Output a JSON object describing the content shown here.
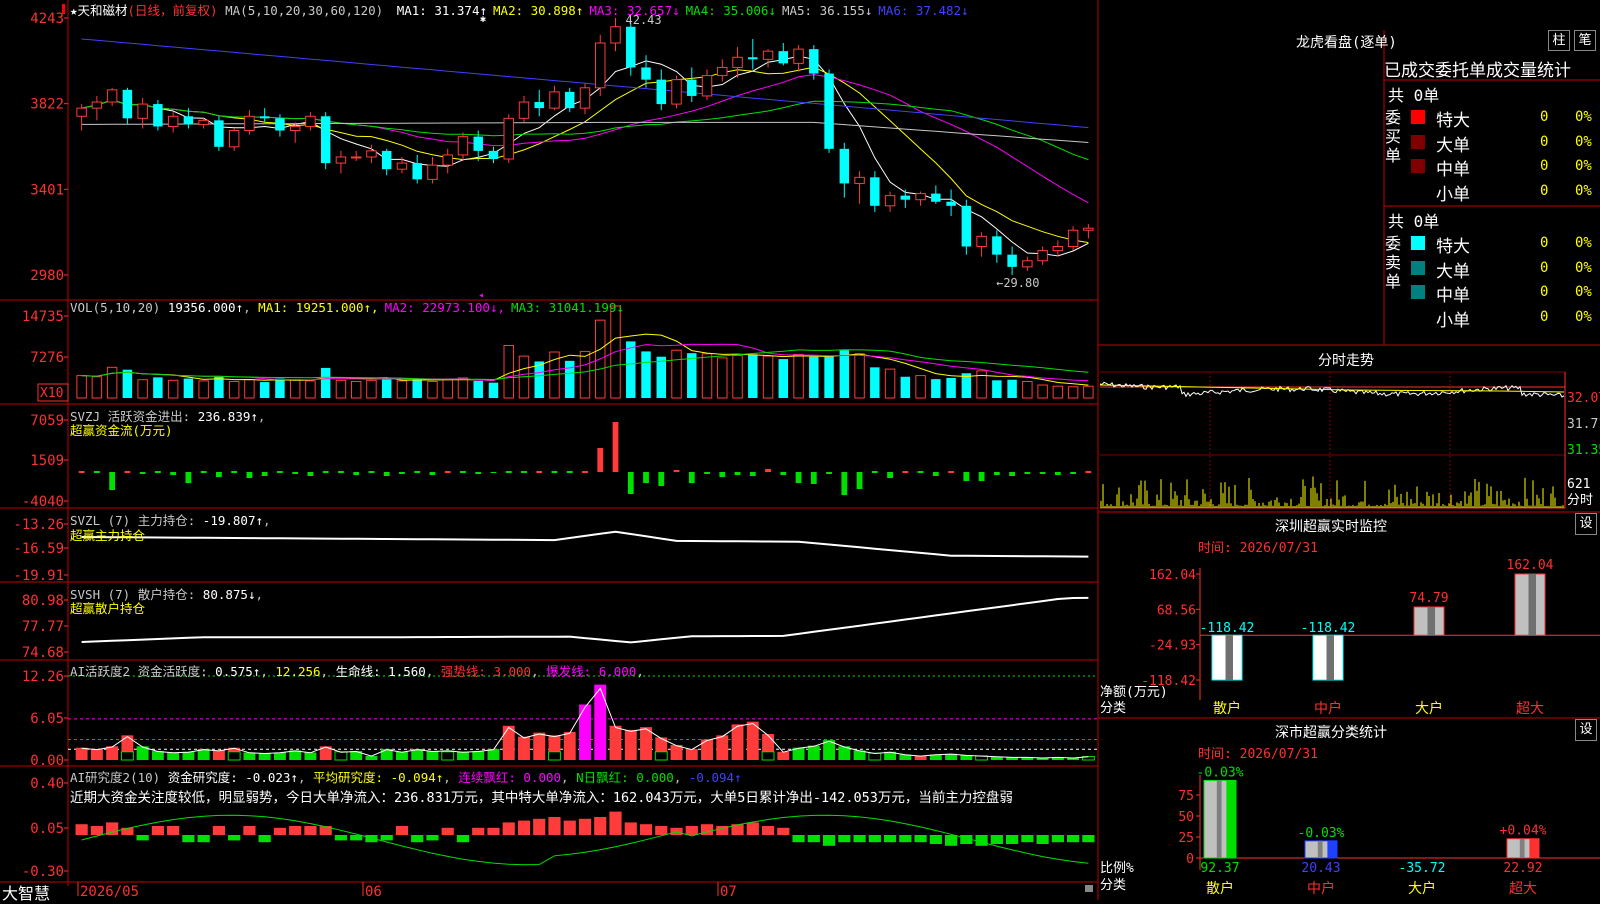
{
  "colors": {
    "up": "#ff3b3b",
    "down": "#00ffff",
    "green": "#00e000",
    "grid": "#c00000",
    "white": "#e8e8e8",
    "yellow": "#ffff00",
    "magenta": "#ff00ff",
    "blue": "#4040ff",
    "text": "#c8c8c8"
  },
  "main": {
    "stock_name": "★天和磁材",
    "period": "(日线，前复权)",
    "ma_header": "MA(5,10,20,30,60,120)",
    "ma": [
      {
        "label": "MA1:",
        "value": "31.374↑",
        "color": "#ffffff"
      },
      {
        "label": "MA2:",
        "value": "30.898↑",
        "color": "#ffff00"
      },
      {
        "label": "MA3:",
        "value": "32.657↓",
        "color": "#ff00ff"
      },
      {
        "label": "MA4:",
        "value": "35.006↓",
        "color": "#00e000"
      },
      {
        "label": "MA5:",
        "value": "36.155↓",
        "color": "#c8c8c8"
      },
      {
        "label": "MA6:",
        "value": "37.482↓",
        "color": "#4040ff"
      }
    ],
    "y_labels": [
      "4243",
      "3822",
      "3401",
      "2980"
    ],
    "high_label": "42.43",
    "low_label": "←29.80",
    "candles": [
      [
        37.6,
        38.2,
        36.9,
        38.0
      ],
      [
        38.0,
        38.6,
        37.4,
        38.3
      ],
      [
        38.3,
        39.0,
        38.1,
        38.9
      ],
      [
        38.9,
        39.0,
        37.2,
        37.5
      ],
      [
        37.5,
        38.5,
        37.0,
        38.2
      ],
      [
        38.2,
        38.4,
        36.9,
        37.1
      ],
      [
        37.1,
        37.8,
        36.8,
        37.6
      ],
      [
        37.6,
        38.0,
        37.0,
        37.2
      ],
      [
        37.2,
        37.5,
        37.0,
        37.4
      ],
      [
        37.4,
        37.6,
        35.9,
        36.1
      ],
      [
        36.1,
        37.0,
        35.9,
        36.9
      ],
      [
        36.9,
        37.9,
        36.7,
        37.6
      ],
      [
        37.6,
        38.0,
        37.3,
        37.5
      ],
      [
        37.5,
        37.7,
        36.6,
        36.9
      ],
      [
        36.9,
        37.3,
        36.3,
        37.1
      ],
      [
        37.1,
        37.8,
        36.9,
        37.6
      ],
      [
        37.6,
        37.8,
        35.0,
        35.3
      ],
      [
        35.3,
        35.9,
        34.8,
        35.6
      ],
      [
        35.6,
        35.9,
        35.4,
        35.6
      ],
      [
        35.6,
        36.2,
        35.3,
        35.9
      ],
      [
        35.9,
        36.0,
        34.7,
        35.0
      ],
      [
        35.0,
        35.6,
        34.8,
        35.3
      ],
      [
        35.3,
        35.7,
        34.3,
        34.5
      ],
      [
        34.5,
        35.6,
        34.3,
        35.2
      ],
      [
        35.2,
        36.0,
        34.8,
        35.7
      ],
      [
        35.7,
        36.8,
        35.4,
        36.6
      ],
      [
        36.6,
        36.9,
        35.4,
        35.9
      ],
      [
        35.9,
        36.1,
        35.3,
        35.5
      ],
      [
        35.5,
        37.7,
        35.3,
        37.5
      ],
      [
        37.5,
        38.6,
        37.3,
        38.3
      ],
      [
        38.3,
        38.9,
        37.6,
        38.0
      ],
      [
        38.0,
        39.1,
        37.9,
        38.8
      ],
      [
        38.8,
        39.0,
        37.8,
        38.0
      ],
      [
        38.0,
        39.2,
        37.7,
        39.0
      ],
      [
        39.0,
        41.6,
        38.6,
        41.2
      ],
      [
        41.2,
        42.43,
        40.8,
        42.0
      ],
      [
        42.0,
        42.2,
        39.6,
        40.0
      ],
      [
        40.0,
        40.6,
        39.0,
        39.4
      ],
      [
        39.4,
        39.9,
        37.9,
        38.2
      ],
      [
        38.2,
        39.6,
        38.0,
        39.4
      ],
      [
        39.4,
        40.0,
        38.3,
        38.6
      ],
      [
        38.6,
        39.9,
        38.4,
        39.6
      ],
      [
        39.6,
        40.4,
        39.3,
        40.0
      ],
      [
        40.0,
        41.0,
        39.5,
        40.5
      ],
      [
        40.5,
        41.4,
        39.9,
        40.4
      ],
      [
        40.4,
        40.9,
        40.0,
        40.8
      ],
      [
        40.8,
        41.2,
        40.1,
        40.2
      ],
      [
        40.2,
        41.1,
        39.8,
        40.9
      ],
      [
        40.9,
        41.1,
        39.4,
        39.7
      ],
      [
        39.7,
        39.9,
        35.8,
        36.0
      ],
      [
        36.0,
        36.3,
        33.6,
        34.3
      ],
      [
        34.3,
        34.9,
        33.3,
        34.6
      ],
      [
        34.6,
        34.9,
        32.9,
        33.2
      ],
      [
        33.2,
        33.9,
        32.9,
        33.7
      ],
      [
        33.7,
        34.0,
        33.1,
        33.5
      ],
      [
        33.5,
        33.9,
        33.2,
        33.8
      ],
      [
        33.8,
        34.2,
        33.3,
        33.4
      ],
      [
        33.4,
        34.0,
        32.7,
        33.2
      ],
      [
        33.2,
        33.5,
        30.8,
        31.2
      ],
      [
        31.2,
        31.9,
        30.7,
        31.7
      ],
      [
        31.7,
        32.0,
        30.4,
        30.8
      ],
      [
        30.8,
        31.2,
        29.8,
        30.2
      ],
      [
        30.2,
        30.7,
        30.0,
        30.5
      ],
      [
        30.5,
        31.2,
        30.3,
        31.0
      ],
      [
        31.0,
        31.5,
        30.7,
        31.2
      ],
      [
        31.2,
        32.2,
        31.0,
        32.0
      ],
      [
        32.0,
        32.3,
        31.6,
        32.1
      ]
    ]
  },
  "vol": {
    "header": "VOL(5,10,20)",
    "value": "19356.000↑",
    "ma": [
      {
        "label": "MA1:",
        "value": "19251.000↑",
        "color": "#ffff00"
      },
      {
        "label": "MA2:",
        "value": "22973.100↓",
        "color": "#ff00ff"
      },
      {
        "label": "MA3:",
        "value": "31041.199↓",
        "color": "#00e000"
      }
    ],
    "y_labels": [
      "14735",
      "7276"
    ],
    "unit": "X10",
    "bars": [
      3.8,
      3.6,
      5.2,
      4.8,
      3.1,
      3.5,
      3.0,
      3.3,
      2.9,
      3.6,
      2.8,
      3.1,
      2.7,
      3.3,
      3.1,
      2.9,
      5.1,
      3.0,
      2.8,
      3.0,
      3.4,
      2.9,
      3.2,
      2.8,
      3.1,
      3.4,
      2.9,
      2.6,
      8.9,
      7.1,
      6.2,
      7.8,
      6.3,
      7.9,
      13.2,
      15.6,
      9.6,
      7.9,
      7.0,
      8.1,
      7.6,
      7.5,
      6.8,
      7.2,
      7.4,
      7.1,
      6.6,
      7.4,
      7.0,
      7.2,
      8.1,
      7.5,
      5.2,
      4.9,
      3.6,
      3.8,
      3.2,
      3.4,
      4.2,
      4.6,
      3.0,
      3.1,
      2.8,
      2.2,
      2.0,
      1.9,
      2.0
    ]
  },
  "svzj": {
    "header": "SVZJ  活跃资金进出:",
    "value": "236.839↑",
    "sub": "超赢资金流(万元)",
    "y_labels": [
      "7059",
      "1509",
      "-4040"
    ],
    "bars": [
      0,
      0,
      -1.8,
      0,
      -0.2,
      0,
      -0.3,
      -1.1,
      0,
      -0.5,
      0,
      -0.6,
      -0.4,
      0,
      -0.2,
      -0.4,
      0,
      0,
      -0.3,
      0,
      -0.4,
      -0.2,
      0,
      -0.3,
      0,
      0,
      -0.2,
      -0.1,
      0,
      0,
      0,
      0,
      0,
      0,
      2.4,
      5.0,
      -2.2,
      -1.1,
      -1.4,
      0.2,
      -1.1,
      -0.2,
      -0.5,
      -0.3,
      -0.4,
      0.3,
      -0.3,
      -1.1,
      -1.2,
      -0.2,
      -2.3,
      -1.7,
      0,
      -0.6,
      0,
      0,
      -0.4,
      0,
      -0.9,
      -0.9,
      -0.3,
      -0.4,
      -0.2,
      -0.2,
      -0.3,
      -0.2,
      0.0
    ]
  },
  "svzl": {
    "header": "SVZL (7) 主力持仓:",
    "value": "-19.807↑",
    "sub": "超赢主力持仓",
    "y_labels": [
      "-13.26",
      "-16.59",
      "-19.91"
    ]
  },
  "svsh": {
    "header": "SVSH (7) 散户持仓:",
    "value": "80.875↓",
    "sub": "超赢散户持仓",
    "y_labels": [
      "80.98",
      "77.77",
      "74.68"
    ]
  },
  "ai1": {
    "header": "AI活跃度2 资金活跃度:",
    "value": "0.575↑",
    "v2": "12.256",
    "l3": "生命线:",
    "v3": "1.560",
    "l4": "强势线:",
    "v4": "3.000",
    "l5": "爆发线:",
    "v5": "6.000",
    "y_labels": [
      "12.26",
      "6.05",
      "0.00"
    ],
    "bars": [
      1.8,
      1.6,
      2.0,
      3.6,
      2.0,
      1.3,
      1.1,
      1.2,
      1.6,
      1.4,
      1.8,
      1.1,
      1.0,
      1.1,
      1.4,
      1.1,
      2.0,
      1.2,
      1.3,
      0.6,
      1.6,
      1.2,
      1.6,
      1.3,
      1.4,
      1.2,
      1.3,
      1.6,
      5.0,
      3.4,
      4.0,
      3.6,
      4.1,
      8.1,
      11.0,
      5.0,
      4.4,
      4.8,
      3.3,
      2.2,
      1.6,
      3.0,
      3.6,
      5.2,
      5.6,
      3.8,
      1.2,
      1.8,
      2.1,
      2.9,
      2.0,
      1.4,
      1.0,
      1.2,
      0.8,
      0.6,
      0.8,
      0.9,
      0.7,
      0.6,
      0.5,
      0.4,
      0.4,
      0.3,
      0.4,
      0.3,
      0.5
    ],
    "up": [
      1,
      1,
      1,
      1,
      0,
      0,
      0,
      0,
      0,
      1,
      1,
      0,
      0,
      0,
      0,
      0,
      1,
      0,
      0,
      0,
      0,
      0,
      0,
      0,
      0,
      0,
      0,
      0,
      1,
      1,
      1,
      1,
      1,
      1,
      1,
      1,
      1,
      1,
      1,
      1,
      1,
      1,
      1,
      1,
      1,
      1,
      1,
      0,
      0,
      0,
      0,
      0,
      0,
      0,
      0,
      1,
      0,
      0,
      0,
      0,
      0,
      0,
      0,
      0,
      0,
      0,
      0
    ]
  },
  "ai2": {
    "header": "AI研究度2(10)",
    "l1": "资金研究度:",
    "v1": "-0.023↑",
    "l2": "平均研究度:",
    "v2": "-0.094↑",
    "l3": "连续飘红:",
    "v3": "0.000",
    "l4": "N日飘红:",
    "v4": "0.000",
    "v5": "-0.094↑",
    "commentary": "近期大资金关注度较低，明显弱势，今日大单净流入：236.831万元，其中特大单净流入：162.043万元，大单5日累计净出-142.053万元，当前主力控盘弱",
    "y_labels": [
      "0.40",
      "0.05",
      "-0.30"
    ],
    "bars": [
      0.06,
      0.05,
      0.07,
      0.04,
      -0.03,
      0.05,
      0.05,
      -0.04,
      -0.04,
      0.05,
      -0.03,
      0.05,
      -0.04,
      0.04,
      0.05,
      0.05,
      0.05,
      -0.03,
      -0.03,
      -0.04,
      -0.03,
      0.05,
      -0.04,
      -0.03,
      0.04,
      -0.04,
      0.04,
      0.04,
      0.07,
      0.08,
      0.09,
      0.1,
      0.08,
      0.09,
      0.1,
      0.13,
      0.07,
      0.06,
      0.05,
      0.04,
      0.05,
      0.06,
      0.05,
      0.06,
      0.07,
      0.05,
      0.04,
      -0.04,
      -0.04,
      -0.06,
      -0.04,
      -0.04,
      -0.04,
      -0.04,
      -0.04,
      -0.04,
      -0.05,
      -0.06,
      -0.05,
      -0.06,
      -0.05,
      -0.05,
      -0.04,
      -0.05,
      -0.04,
      -0.04,
      -0.04
    ]
  },
  "xaxis": {
    "labels": [
      "2026/05",
      "06",
      "07"
    ],
    "left_label": "大智慧"
  },
  "dragon": {
    "title": "龙虎看盘(逐单)",
    "btn1": "柱",
    "btn2": "笔",
    "tabs_header": "已成交委托单成交量统计",
    "buy": {
      "side": "委买单",
      "total": "共 0单",
      "rows": [
        {
          "name": "特大",
          "count": "0",
          "pct": "0%",
          "color": "#ff0000"
        },
        {
          "name": "大单",
          "count": "0",
          "pct": "0%",
          "color": "#800000"
        },
        {
          "name": "中单",
          "count": "0",
          "pct": "0%",
          "color": "#800000"
        },
        {
          "name": "小单",
          "count": "0",
          "pct": "0%",
          "color": ""
        }
      ]
    },
    "sell": {
      "side": "委卖单",
      "total": "共 0单",
      "rows": [
        {
          "name": "特大",
          "count": "0",
          "pct": "0%",
          "color": "#00ffff"
        },
        {
          "name": "大单",
          "count": "0",
          "pct": "0%",
          "color": "#008080"
        },
        {
          "name": "中单",
          "count": "0",
          "pct": "0%",
          "color": "#008080"
        },
        {
          "name": "小单",
          "count": "0",
          "pct": "0%",
          "color": ""
        }
      ]
    }
  },
  "intraday": {
    "title": "分时走势",
    "prices": [
      "32.07",
      "31.71",
      "31.35"
    ],
    "vol_label": "621",
    "time_label": "分时"
  },
  "sz_monitor": {
    "title": "深圳超赢实时监控",
    "btn": "设",
    "date_label": "时间: 2026/07/31",
    "y_labels": [
      "162.04",
      "68.56",
      "-24.93",
      "-118.42"
    ],
    "y_title1": "净额(万元)",
    "y_title2": "分类",
    "categories": [
      "散户",
      "中户",
      "大户",
      "超大"
    ],
    "values": [
      -118.42,
      -118.42,
      74.79,
      162.04
    ],
    "value_labels": [
      "-118.42",
      "-118.42",
      "74.79",
      "162.04"
    ]
  },
  "sz_class": {
    "title": "深市超赢分类统计",
    "btn": "设",
    "date_label": "时间: 2026/07/31",
    "y_labels": [
      "75",
      "50",
      "25",
      "0"
    ],
    "y_title1": "比例%",
    "y_title2": "分类",
    "categories": [
      "散户",
      "中户",
      "大户",
      "超大"
    ],
    "top_labels": [
      "-0.03%",
      "-0.03%",
      "",
      "+0.04%"
    ],
    "values": [
      92.37,
      20.43,
      -35.72,
      22.92
    ],
    "value_labels": [
      "92.37",
      "20.43",
      "-35.72",
      "22.92"
    ],
    "bar_colors": [
      "#00e000",
      "#2040ff",
      "#00ffff",
      "#ff3030"
    ]
  }
}
